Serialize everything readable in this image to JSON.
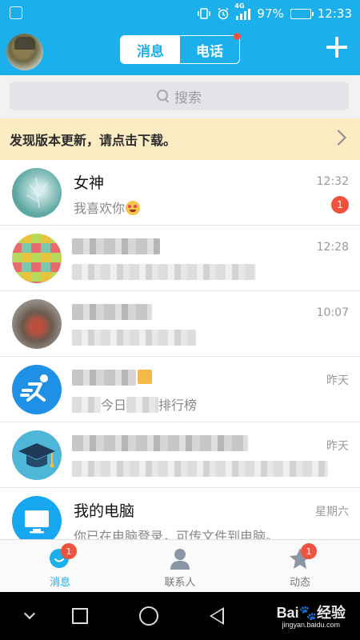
{
  "status_bar": {
    "battery": "97%",
    "time": "12:33",
    "network": "4G",
    "battery_fraction": 0.97
  },
  "header": {
    "tabs": [
      {
        "label": "消息",
        "active": true
      },
      {
        "label": "电话",
        "active": false,
        "dot": true
      }
    ],
    "add_icon": "plus-icon"
  },
  "search": {
    "placeholder": "搜索",
    "icon": "search-icon"
  },
  "update_banner": {
    "text": "发现版本更新，请点击下载。",
    "icon": "chevron-right-icon"
  },
  "conversations": [
    {
      "name": "女神",
      "message": "我喜欢你",
      "time": "12:32",
      "unread": "1",
      "emoji": "smiling-face-with-heart-eyes"
    },
    {
      "name": "",
      "message": "",
      "time": "12:28",
      "blurred": true
    },
    {
      "name": "",
      "message": "",
      "time": "10:07",
      "blurred": true
    },
    {
      "name": "",
      "message": "今日",
      "message_tail": "排行榜",
      "time": "昨天",
      "blurred": true
    },
    {
      "name": "",
      "message": "",
      "time": "昨天",
      "blurred": true
    },
    {
      "name": "我的电脑",
      "message": "你已在电脑登录，可传文件到电脑。",
      "time": "星期六"
    }
  ],
  "tabbar": [
    {
      "label": "消息",
      "active": true,
      "badge": "1",
      "icon": "message-bubble-icon"
    },
    {
      "label": "联系人",
      "active": false,
      "icon": "contacts-person-icon"
    },
    {
      "label": "动态",
      "active": false,
      "badge": "1",
      "icon": "star-icon"
    }
  ],
  "navbar": {
    "icons": [
      "chevron-down-icon",
      "recent-apps-icon",
      "home-icon",
      "back-icon"
    ]
  },
  "watermark": {
    "brand": "Bai",
    "brand_tail": "经验",
    "url": "jingyan.baidu.com"
  },
  "colors": {
    "accent": "#1bb0ec",
    "badge": "#f1523f",
    "banner": "#fcecc4"
  }
}
